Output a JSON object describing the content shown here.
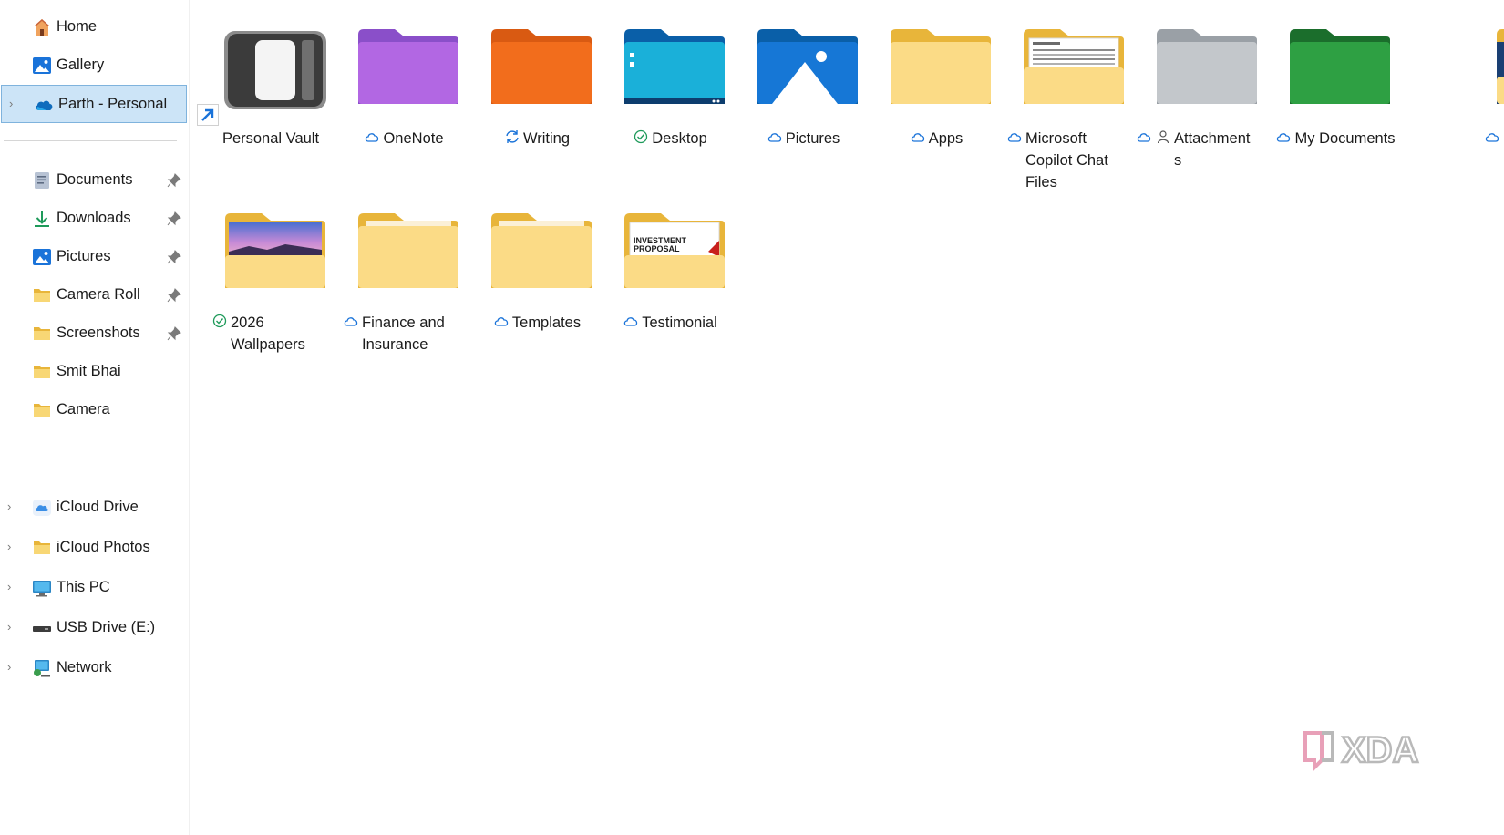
{
  "sidebar": {
    "quick": [
      {
        "label": "Home",
        "icon": "home-icon"
      },
      {
        "label": "Gallery",
        "icon": "gallery-icon"
      },
      {
        "label": "Parth - Personal",
        "icon": "onedrive-cloud-icon",
        "selected": true
      }
    ],
    "pinned": [
      {
        "label": "Documents",
        "icon": "documents-icon",
        "pinned": true
      },
      {
        "label": "Downloads",
        "icon": "downloads-icon",
        "pinned": true
      },
      {
        "label": "Pictures",
        "icon": "pictures-icon",
        "pinned": true
      },
      {
        "label": "Camera Roll",
        "icon": "folder-icon",
        "pinned": true
      },
      {
        "label": "Screenshots",
        "icon": "folder-icon",
        "pinned": true
      },
      {
        "label": "Smit Bhai",
        "icon": "folder-icon",
        "pinned": false
      },
      {
        "label": "Camera",
        "icon": "folder-icon",
        "pinned": false
      }
    ],
    "locations": [
      {
        "label": "iCloud Drive",
        "icon": "icloud-drive-icon"
      },
      {
        "label": "iCloud Photos",
        "icon": "folder-icon"
      },
      {
        "label": "This PC",
        "icon": "this-pc-icon"
      },
      {
        "label": "USB Drive (E:)",
        "icon": "usb-drive-icon"
      },
      {
        "label": "Network",
        "icon": "network-icon"
      }
    ]
  },
  "folders": [
    {
      "name": "Personal Vault",
      "status": "none",
      "art": "vault-icon"
    },
    {
      "name": "OneNote",
      "status": "cloud",
      "art": "folder-purple-icon"
    },
    {
      "name": "Writing",
      "status": "sync",
      "art": "folder-orange-icon"
    },
    {
      "name": "Desktop",
      "status": "synced",
      "art": "desktop-folder-icon"
    },
    {
      "name": "Pictures",
      "status": "cloud",
      "art": "pictures-folder-icon"
    },
    {
      "name": "Apps",
      "status": "cloud",
      "art": "folder-yellow-icon"
    },
    {
      "name": "Microsoft Copilot Chat Files",
      "status": "cloud",
      "art": "folder-document-preview-icon"
    },
    {
      "name": "Attachments",
      "status": "cloud-shared",
      "art": "folder-gray-icon"
    },
    {
      "name": "My Documents",
      "status": "cloud",
      "art": "folder-green-icon"
    },
    {
      "name": "2026 Wallpapers",
      "status": "synced",
      "art": "folder-wallpaper-preview-icon"
    },
    {
      "name": "Finance and Insurance",
      "status": "cloud",
      "art": "folder-yellow-icon"
    },
    {
      "name": "Templates",
      "status": "cloud",
      "art": "folder-yellow-icon"
    },
    {
      "name": "Testimonial",
      "status": "cloud",
      "art": "folder-investment-preview-icon"
    }
  ],
  "thumbnail_text": {
    "investment_title": "INVESTMENT PROPOSAL"
  },
  "watermark": "XDA",
  "colors": {
    "selection_bg": "#cce4f7",
    "selection_border": "#7fb3dd",
    "folder_yellow": "#f8d775",
    "onedrive_blue": "#0f6cbd"
  }
}
